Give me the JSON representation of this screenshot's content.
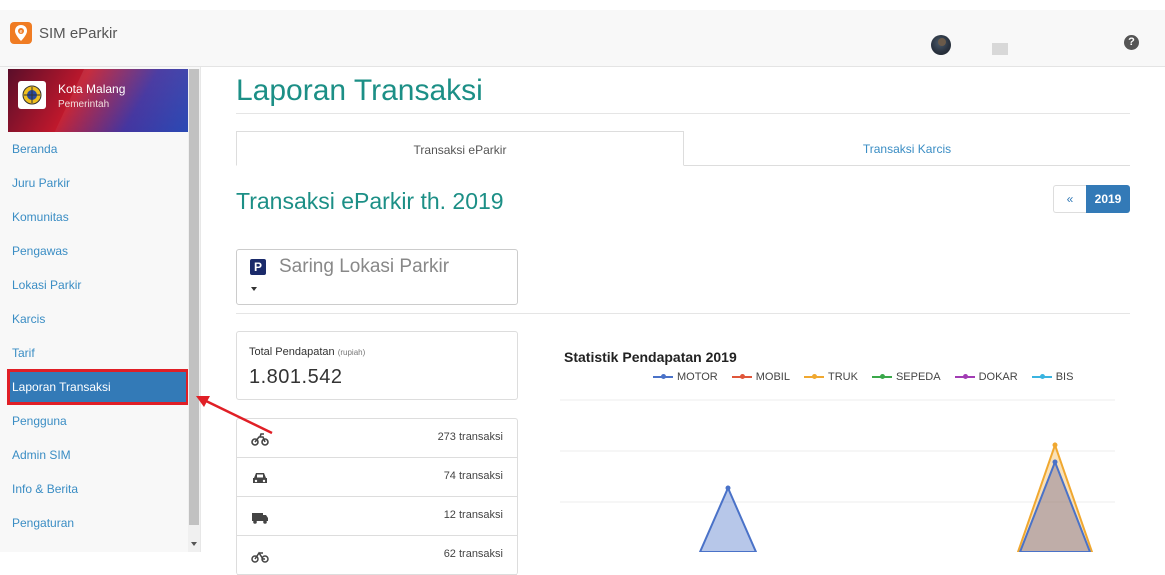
{
  "app": {
    "title": "SIM eParkir"
  },
  "sidebar": {
    "org_name": "Kota Malang",
    "org_sub": "Pemerintah",
    "items": [
      {
        "label": "Beranda"
      },
      {
        "label": "Juru Parkir"
      },
      {
        "label": "Komunitas"
      },
      {
        "label": "Pengawas"
      },
      {
        "label": "Lokasi Parkir"
      },
      {
        "label": "Karcis"
      },
      {
        "label": "Tarif"
      },
      {
        "label": "Laporan Transaksi",
        "active": true
      },
      {
        "label": "Pengguna"
      },
      {
        "label": "Admin SIM"
      },
      {
        "label": "Info & Berita"
      },
      {
        "label": "Pengaturan"
      }
    ]
  },
  "main": {
    "title": "Laporan Transaksi",
    "tabs": [
      {
        "label": "Transaksi eParkir",
        "active": true
      },
      {
        "label": "Transaksi Karcis"
      }
    ],
    "section_title": "Transaksi eParkir th. 2019",
    "pager": {
      "prev": "«",
      "year": "2019"
    },
    "filter": {
      "label": "Saring Lokasi Parkir",
      "icon": "parking-icon"
    },
    "total": {
      "label": "Total Pendapatan",
      "unit": "(rupiah)",
      "value": "1.801.542"
    },
    "transactions": [
      {
        "icon": "motorcycle-icon",
        "count": "273 transaksi"
      },
      {
        "icon": "car-icon",
        "count": "74 transaksi"
      },
      {
        "icon": "truck-icon",
        "count": "12 transaksi"
      },
      {
        "icon": "bicycle-icon",
        "count": "62 transaksi"
      }
    ]
  },
  "chart_data": {
    "type": "area",
    "title": "Statistik Pendapatan 2019",
    "series": [
      {
        "name": "MOTOR",
        "color": "#4a72c8"
      },
      {
        "name": "MOBIL",
        "color": "#e0563a"
      },
      {
        "name": "TRUK",
        "color": "#f0a830"
      },
      {
        "name": "SEPEDA",
        "color": "#3aa84a"
      },
      {
        "name": "DOKAR",
        "color": "#a23cb4"
      },
      {
        "name": "BIS",
        "color": "#3ab4e0"
      }
    ],
    "grid": true,
    "legend_position": "top"
  }
}
